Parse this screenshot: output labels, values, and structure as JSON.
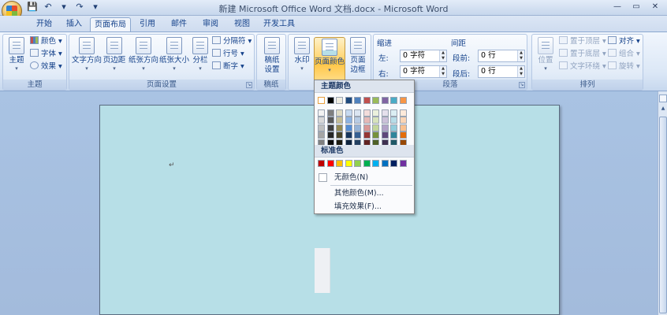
{
  "window": {
    "title": "新建 Microsoft Office Word 文档.docx - Microsoft Word",
    "controls": [
      "—",
      "▭",
      "✕"
    ]
  },
  "qat": [
    "💾",
    "↶",
    "▾",
    "↷",
    "▾"
  ],
  "tabs": [
    "开始",
    "插入",
    "页面布局",
    "引用",
    "邮件",
    "审阅",
    "视图",
    "开发工具"
  ],
  "active_tab": "页面布局",
  "ribbon": {
    "theme": {
      "title": "主题",
      "big": "主题",
      "colors": "颜色 ▾",
      "fonts": "字体 ▾",
      "effects": "效果 ▾"
    },
    "page_setup": {
      "title": "页面设置",
      "text_direction": "文字方向",
      "margins": "页边距",
      "orientation": "纸张方向",
      "size": "纸张大小",
      "columns": "分栏",
      "breaks": "分隔符 ▾",
      "line_numbers": "行号 ▾",
      "hyphenation": "断字 ▾"
    },
    "manuscript": {
      "title": "稿纸",
      "btn_line1": "稿纸",
      "btn_line2": "设置"
    },
    "page_bg": {
      "watermark": "水印",
      "page_color": "页面颜色",
      "page_border_line1": "页面",
      "page_border_line2": "边框"
    },
    "paragraph": {
      "title": "段落",
      "indent_label": "缩进",
      "spacing_label": "间距",
      "left_label": "左:",
      "right_label": "右:",
      "before_label": "段前:",
      "after_label": "段后:",
      "left_value": "0 字符",
      "right_value": "0 字符",
      "before_value": "0 行",
      "after_value": "0 行"
    },
    "arrange": {
      "title": "排列",
      "position": "位置",
      "bring_front": "置于顶层 ▾",
      "send_back": "置于底层 ▾",
      "text_wrap": "文字环绕 ▾",
      "align": "对齐 ▾",
      "group": "组合 ▾",
      "rotate": "旋转 ▾"
    }
  },
  "dropdown": {
    "theme_colors_header": "主题颜色",
    "standard_colors_header": "标准色",
    "no_color": "无颜色(N)",
    "more_colors": "其他颜色(M)...",
    "fill_effects": "填充效果(F)...",
    "theme_columns": [
      [
        "#ffffff",
        "#f2f2f2",
        "#d9d9d9",
        "#bfbfbf",
        "#a6a6a6",
        "#808080"
      ],
      [
        "#000000",
        "#7f7f7f",
        "#595959",
        "#3f3f3f",
        "#262626",
        "#0d0d0d"
      ],
      [
        "#eeece1",
        "#ddd9c3",
        "#c4bd97",
        "#938953",
        "#494429",
        "#1d1b10"
      ],
      [
        "#1f497d",
        "#c6d9f0",
        "#8db3e2",
        "#548dd4",
        "#17365d",
        "#0f243e"
      ],
      [
        "#4f81bd",
        "#dbe5f1",
        "#b8cce4",
        "#95b3d7",
        "#366092",
        "#244061"
      ],
      [
        "#c0504d",
        "#f2dcdb",
        "#e5b9b7",
        "#d99694",
        "#953734",
        "#632423"
      ],
      [
        "#9bbb59",
        "#ebf1dd",
        "#d7e3bc",
        "#c3d69b",
        "#76923c",
        "#4f6128"
      ],
      [
        "#8064a2",
        "#e5e0ec",
        "#ccc1d9",
        "#b2a2c7",
        "#5f497a",
        "#3f3151"
      ],
      [
        "#4bacc6",
        "#dbeef3",
        "#b7dde8",
        "#92cddc",
        "#31859b",
        "#205867"
      ],
      [
        "#f79646",
        "#fdeada",
        "#fbd5b5",
        "#fac08f",
        "#e36c09",
        "#974806"
      ]
    ],
    "standard_colors": [
      "#c00000",
      "#ff0000",
      "#ffc000",
      "#ffff00",
      "#92d050",
      "#00b050",
      "#00b0f0",
      "#0070c0",
      "#002060",
      "#7030a0"
    ]
  },
  "document": {
    "page_color": "#b7dfe7",
    "paragraph_mark": "↵"
  }
}
